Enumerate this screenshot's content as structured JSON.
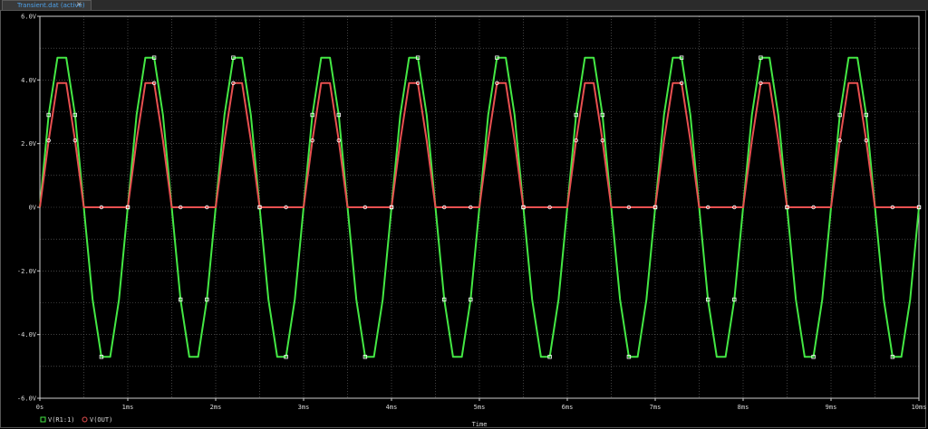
{
  "tab": {
    "label": "Transient.dat (active)"
  },
  "chart_data": {
    "type": "line",
    "xlabel": "Time",
    "ylabel": "",
    "xlim": [
      0,
      10
    ],
    "ylim": [
      -6,
      6
    ],
    "grid": true,
    "legend_placement": "bottom-left",
    "x_ticks": [
      {
        "v": 0,
        "label": "0s"
      },
      {
        "v": 1,
        "label": "1ms"
      },
      {
        "v": 2,
        "label": "2ms"
      },
      {
        "v": 3,
        "label": "3ms"
      },
      {
        "v": 4,
        "label": "4ms"
      },
      {
        "v": 5,
        "label": "5ms"
      },
      {
        "v": 6,
        "label": "6ms"
      },
      {
        "v": 7,
        "label": "7ms"
      },
      {
        "v": 8,
        "label": "8ms"
      },
      {
        "v": 9,
        "label": "9ms"
      },
      {
        "v": 10,
        "label": "10ms"
      }
    ],
    "y_ticks": [
      {
        "v": 6,
        "label": "6.0V"
      },
      {
        "v": 4,
        "label": "4.0V"
      },
      {
        "v": 2,
        "label": "2.0V"
      },
      {
        "v": 0,
        "label": "0V"
      },
      {
        "v": -2,
        "label": "-2.0V"
      },
      {
        "v": -4,
        "label": "-4.0V"
      },
      {
        "v": -6,
        "label": "-6.0V"
      }
    ],
    "series": [
      {
        "name": "V(R1:1)",
        "color": "#44e844",
        "marker": "square",
        "x": [
          0,
          0.1,
          0.2,
          0.3,
          0.4,
          0.5,
          0.6,
          0.7,
          0.8,
          0.9,
          1.0,
          1.1,
          1.2,
          1.3,
          1.4,
          1.5,
          1.6,
          1.7,
          1.8,
          1.9,
          2.0,
          2.1,
          2.2,
          2.3,
          2.4,
          2.5,
          2.6,
          2.7,
          2.8,
          2.9,
          3.0,
          3.1,
          3.2,
          3.3,
          3.4,
          3.5,
          3.6,
          3.7,
          3.8,
          3.9,
          4.0,
          4.1,
          4.2,
          4.3,
          4.4,
          4.5,
          4.6,
          4.7,
          4.8,
          4.9,
          5.0,
          5.1,
          5.2,
          5.3,
          5.4,
          5.5,
          5.6,
          5.7,
          5.8,
          5.9,
          6.0,
          6.1,
          6.2,
          6.3,
          6.4,
          6.5,
          6.6,
          6.7,
          6.8,
          6.9,
          7.0,
          7.1,
          7.2,
          7.3,
          7.4,
          7.5,
          7.6,
          7.7,
          7.8,
          7.9,
          8.0,
          8.1,
          8.2,
          8.3,
          8.4,
          8.5,
          8.6,
          8.7,
          8.8,
          8.9,
          9.0,
          9.1,
          9.2,
          9.3,
          9.4,
          9.5,
          9.6,
          9.7,
          9.8,
          9.9,
          10.0
        ],
        "values": [
          0,
          2.9,
          4.7,
          4.7,
          2.9,
          0,
          -2.9,
          -4.7,
          -4.7,
          -2.9,
          0,
          2.9,
          4.7,
          4.7,
          2.9,
          0,
          -2.9,
          -4.7,
          -4.7,
          -2.9,
          0,
          2.9,
          4.7,
          4.7,
          2.9,
          0,
          -2.9,
          -4.7,
          -4.7,
          -2.9,
          0,
          2.9,
          4.7,
          4.7,
          2.9,
          0,
          -2.9,
          -4.7,
          -4.7,
          -2.9,
          0,
          2.9,
          4.7,
          4.7,
          2.9,
          0,
          -2.9,
          -4.7,
          -4.7,
          -2.9,
          0,
          2.9,
          4.7,
          4.7,
          2.9,
          0,
          -2.9,
          -4.7,
          -4.7,
          -2.9,
          0,
          2.9,
          4.7,
          4.7,
          2.9,
          0,
          -2.9,
          -4.7,
          -4.7,
          -2.9,
          0,
          2.9,
          4.7,
          4.7,
          2.9,
          0,
          -2.9,
          -4.7,
          -4.7,
          -2.9,
          0,
          2.9,
          4.7,
          4.7,
          2.9,
          0,
          -2.9,
          -4.7,
          -4.7,
          -2.9,
          0,
          2.9,
          4.7,
          4.7,
          2.9,
          0,
          -2.9,
          -4.7,
          -4.7,
          -2.9,
          0
        ]
      },
      {
        "name": "V(OUT)",
        "color": "#e85050",
        "marker": "circle",
        "x": [
          0,
          0.1,
          0.2,
          0.3,
          0.4,
          0.5,
          0.6,
          0.7,
          0.8,
          0.9,
          1.0,
          1.1,
          1.2,
          1.3,
          1.4,
          1.5,
          1.6,
          1.7,
          1.8,
          1.9,
          2.0,
          2.1,
          2.2,
          2.3,
          2.4,
          2.5,
          2.6,
          2.7,
          2.8,
          2.9,
          3.0,
          3.1,
          3.2,
          3.3,
          3.4,
          3.5,
          3.6,
          3.7,
          3.8,
          3.9,
          4.0,
          4.1,
          4.2,
          4.3,
          4.4,
          4.5,
          4.6,
          4.7,
          4.8,
          4.9,
          5.0,
          5.1,
          5.2,
          5.3,
          5.4,
          5.5,
          5.6,
          5.7,
          5.8,
          5.9,
          6.0,
          6.1,
          6.2,
          6.3,
          6.4,
          6.5,
          6.6,
          6.7,
          6.8,
          6.9,
          7.0,
          7.1,
          7.2,
          7.3,
          7.4,
          7.5,
          7.6,
          7.7,
          7.8,
          7.9,
          8.0,
          8.1,
          8.2,
          8.3,
          8.4,
          8.5,
          8.6,
          8.7,
          8.8,
          8.9,
          9.0,
          9.1,
          9.2,
          9.3,
          9.4,
          9.5,
          9.6,
          9.7,
          9.8,
          9.9,
          10.0
        ],
        "values": [
          0,
          2.1,
          3.9,
          3.9,
          2.1,
          0,
          0,
          0,
          0,
          0,
          0,
          2.1,
          3.9,
          3.9,
          2.1,
          0,
          0,
          0,
          0,
          0,
          0,
          2.1,
          3.9,
          3.9,
          2.1,
          0,
          0,
          0,
          0,
          0,
          0,
          2.1,
          3.9,
          3.9,
          2.1,
          0,
          0,
          0,
          0,
          0,
          0,
          2.1,
          3.9,
          3.9,
          2.1,
          0,
          0,
          0,
          0,
          0,
          0,
          2.1,
          3.9,
          3.9,
          2.1,
          0,
          0,
          0,
          0,
          0,
          0,
          2.1,
          3.9,
          3.9,
          2.1,
          0,
          0,
          0,
          0,
          0,
          0,
          2.1,
          3.9,
          3.9,
          2.1,
          0,
          0,
          0,
          0,
          0,
          0,
          2.1,
          3.9,
          3.9,
          2.1,
          0,
          0,
          0,
          0,
          0,
          0,
          2.1,
          3.9,
          3.9,
          2.1,
          0,
          0,
          0,
          0,
          0,
          0
        ]
      }
    ]
  }
}
